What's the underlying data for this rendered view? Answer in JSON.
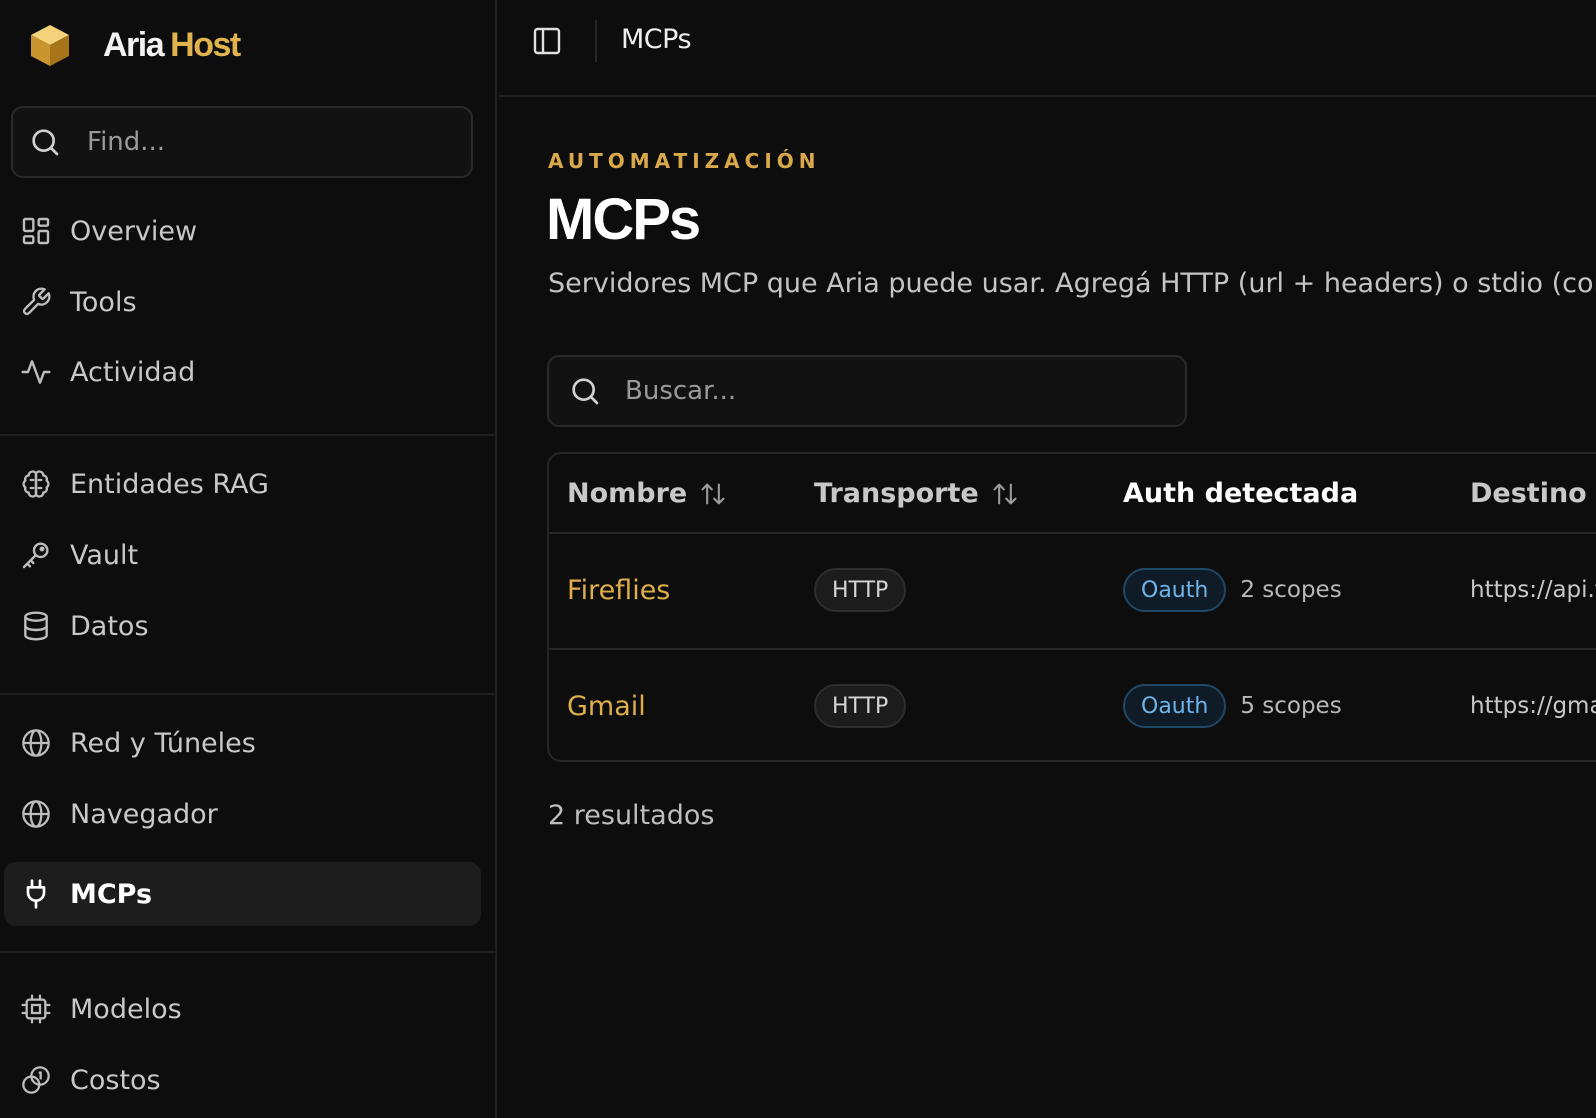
{
  "brand": {
    "name_part1": "Aria",
    "name_part2": "Host",
    "logo_icon": "gold-cube-icon",
    "accent": "#e0b34c"
  },
  "sidebar": {
    "find_placeholder": "Find...",
    "items": [
      {
        "label": "Overview",
        "icon": "dashboard-grid-icon"
      },
      {
        "label": "Tools",
        "icon": "wrench-icon"
      },
      {
        "label": "Actividad",
        "icon": "activity-icon"
      },
      {
        "label": "Entidades RAG",
        "icon": "brain-icon"
      },
      {
        "label": "Vault",
        "icon": "key-icon"
      },
      {
        "label": "Datos",
        "icon": "database-icon"
      },
      {
        "label": "Red y Túneles",
        "icon": "globe-icon"
      },
      {
        "label": "Navegador",
        "icon": "globe-icon"
      },
      {
        "label": "MCPs",
        "icon": "plug-icon",
        "active": true
      },
      {
        "label": "Modelos",
        "icon": "cpu-icon"
      },
      {
        "label": "Costos",
        "icon": "coins-icon"
      }
    ]
  },
  "topbar": {
    "title": "MCPs",
    "toggle_icon": "sidebar-toggle-icon"
  },
  "main": {
    "eyebrow": "AUTOMATIZACIÓN",
    "title": "MCPs",
    "description": "Servidores MCP que Aria puede usar. Agregá HTTP (url + headers) o stdio (com",
    "search_placeholder": "Buscar...",
    "table": {
      "columns": [
        "Nombre",
        "Transporte",
        "Auth detectada",
        "Destino"
      ],
      "rows": [
        {
          "nombre": "Fireflies",
          "transporte": "HTTP",
          "auth": "Oauth",
          "scopes": "2 scopes",
          "destino": "https://api.fireflies.ai/mcp"
        },
        {
          "nombre": "Gmail",
          "transporte": "HTTP",
          "auth": "Oauth",
          "scopes": "5 scopes",
          "destino": "https://gmail.googleapis.com/mcp"
        }
      ]
    },
    "results": "2 resultados"
  },
  "colors": {
    "background": "#0d0d0d",
    "gold": "#dfae4b",
    "oauth_blue": "#6fb4e8"
  }
}
